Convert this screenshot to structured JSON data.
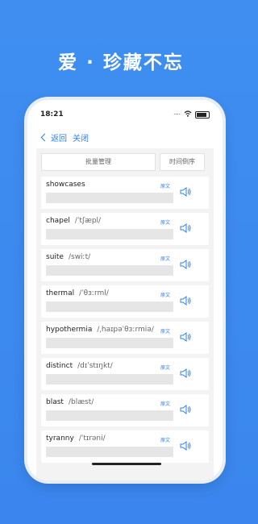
{
  "headline": "爱 · 珍藏不忘",
  "status_bar": {
    "time": "18:21",
    "signal_text": "····"
  },
  "nav": {
    "back_label": "返回",
    "close_label": "关闭"
  },
  "toolbar": {
    "manage_label": "批量管理",
    "sort_label": "时间倒序"
  },
  "source_label": "原文",
  "words": [
    {
      "word": "showcases",
      "phonetic": ""
    },
    {
      "word": "chapel",
      "phonetic": "/ˈtʃæpl/"
    },
    {
      "word": "suite",
      "phonetic": "/swiːt/"
    },
    {
      "word": "thermal",
      "phonetic": "/ˈθɜːrml/"
    },
    {
      "word": "hypothermia",
      "phonetic": "/ˌhaɪpəˈθɜːrmiə/"
    },
    {
      "word": "distinct",
      "phonetic": "/dɪˈstɪŋkt/"
    },
    {
      "word": "blast",
      "phonetic": "/blæst/"
    },
    {
      "word": "tyranny",
      "phonetic": "/ˈtɪrəni/"
    }
  ],
  "colors": {
    "background": "#3f8ef0",
    "accent": "#2f80ed"
  }
}
